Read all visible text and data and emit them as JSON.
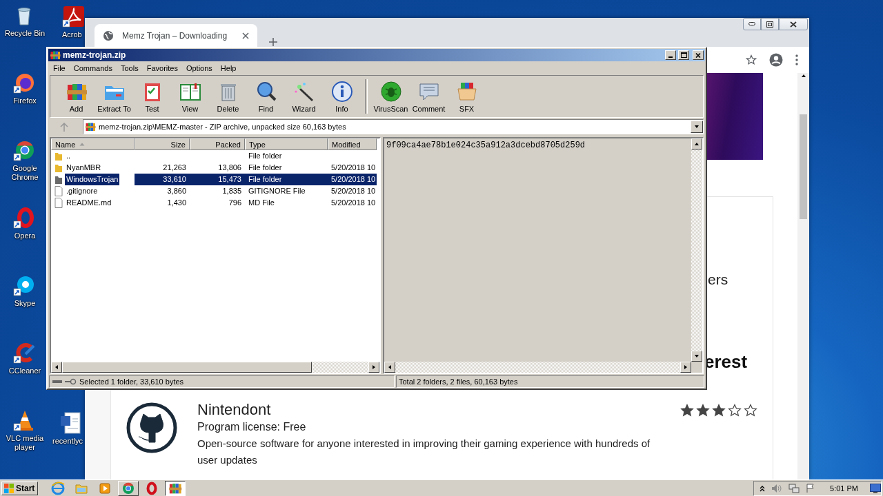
{
  "desktop": {
    "icons": [
      {
        "label": "Recycle Bin"
      },
      {
        "label": "Firefox"
      },
      {
        "label": "Google Chrome"
      },
      {
        "label": "Opera"
      },
      {
        "label": "Skype"
      },
      {
        "label": "CCleaner"
      },
      {
        "label": "VLC media player"
      }
    ],
    "second_column": [
      {
        "label": "Acrob"
      },
      {
        "label": "recentlyc"
      }
    ]
  },
  "browser": {
    "tab": {
      "title": "Memz Trojan – Downloading"
    },
    "content": {
      "fragments": [
        "ers",
        "erest"
      ],
      "app": {
        "title": "Nintendont",
        "license": "Program license: Free",
        "description": "Open-source software for anyone interested in improving their gaming experience with hundreds of user updates",
        "stars": 3
      }
    }
  },
  "winrar": {
    "title": "memz-trojan.zip",
    "menu": [
      "File",
      "Commands",
      "Tools",
      "Favorites",
      "Options",
      "Help"
    ],
    "toolbar": [
      [
        "Add",
        "Extract To",
        "Test",
        "View",
        "Delete",
        "Find",
        "Wizard",
        "Info"
      ],
      [
        "VirusScan",
        "Comment",
        "SFX"
      ]
    ],
    "path": "memz-trojan.zip\\MEMZ-master - ZIP archive, unpacked size 60,163 bytes",
    "columns": [
      {
        "label": "Name",
        "sorted": true
      },
      {
        "label": "Size",
        "sorted": false
      },
      {
        "label": "Packed",
        "sorted": false
      },
      {
        "label": "Type",
        "sorted": false
      },
      {
        "label": "Modified",
        "sorted": false
      }
    ],
    "rows": [
      {
        "kind": "folder",
        "name": "..",
        "type": "File folder",
        "selected": false
      },
      {
        "kind": "folder",
        "name": "NyanMBR",
        "size": "21,263",
        "packed": "13,806",
        "type": "File folder",
        "modified": "5/20/2018 10",
        "selected": false
      },
      {
        "kind": "folder",
        "name": "WindowsTrojan",
        "size": "33,610",
        "packed": "15,473",
        "type": "File folder",
        "modified": "5/20/2018 10",
        "selected": true
      },
      {
        "kind": "file",
        "name": ".gitignore",
        "size": "3,860",
        "packed": "1,835",
        "type": "GITIGNORE File",
        "modified": "5/20/2018 10",
        "selected": false
      },
      {
        "kind": "file",
        "name": "README.md",
        "size": "1,430",
        "packed": "796",
        "type": "MD File",
        "modified": "5/20/2018 10",
        "selected": false
      }
    ],
    "comment": "9f09ca4ae78b1e024c35a912a3dcebd8705d259d",
    "status_left": "Selected 1 folder, 33,610 bytes",
    "status_right": "Total 2 folders, 2 files, 60,163 bytes"
  },
  "taskbar": {
    "start": "Start",
    "apps": [
      {
        "running": false,
        "selected": false
      },
      {
        "running": false,
        "selected": false
      },
      {
        "running": false,
        "selected": false
      },
      {
        "running": true,
        "selected": false
      },
      {
        "running": false,
        "selected": false
      },
      {
        "running": true,
        "selected": true
      }
    ],
    "clock": "5:01 PM"
  }
}
